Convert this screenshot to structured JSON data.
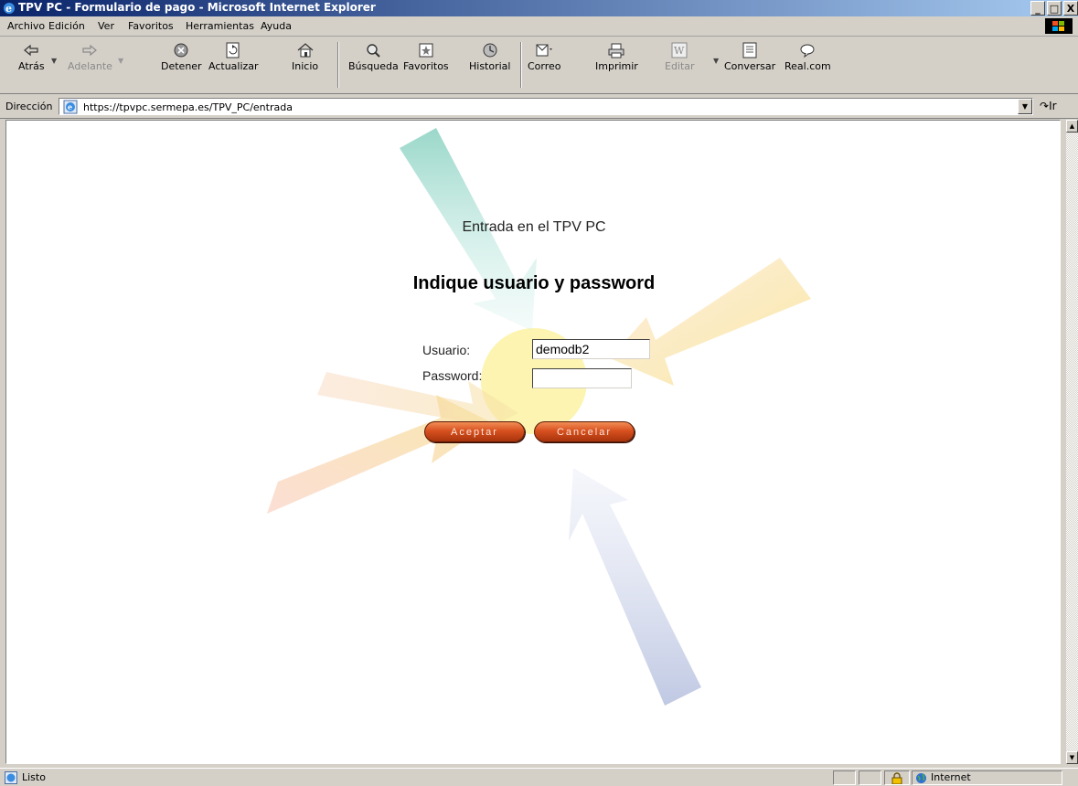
{
  "window": {
    "title": "TPV PC - Formulario de pago - Microsoft Internet Explorer",
    "controls": [
      "_",
      "□",
      "X"
    ]
  },
  "menu": {
    "items": [
      "Archivo",
      "Edición",
      "Ver",
      "Favoritos",
      "Herramientas",
      "Ayuda"
    ]
  },
  "toolbar": {
    "buttons": [
      {
        "label": "Atrás",
        "icon": "back-arrow-icon"
      },
      {
        "label": "Adelante",
        "icon": "forward-arrow-icon",
        "disabled": true
      },
      {
        "label": "Detener",
        "icon": "stop-icon"
      },
      {
        "label": "Actualizar",
        "icon": "refresh-icon"
      },
      {
        "label": "Inicio",
        "icon": "home-icon"
      },
      {
        "label": "Búsqueda",
        "icon": "search-icon"
      },
      {
        "label": "Favoritos",
        "icon": "favorites-icon"
      },
      {
        "label": "Historial",
        "icon": "history-icon"
      },
      {
        "label": "Correo",
        "icon": "mail-icon"
      },
      {
        "label": "Imprimir",
        "icon": "print-icon"
      },
      {
        "label": "Editar",
        "icon": "edit-icon",
        "disabled": true
      },
      {
        "label": "Conversar",
        "icon": "discuss-icon"
      },
      {
        "label": "Real.com",
        "icon": "realcom-icon"
      }
    ]
  },
  "address": {
    "label": "Dirección",
    "url": "https://tpvpc.sermepa.es/TPV_PC/entrada",
    "go_label": "Ir"
  },
  "page": {
    "entrada_title": "Entrada en el TPV PC",
    "heading": "Indique usuario y password",
    "usuario_label": "Usuario:",
    "usuario_value": "demodb2",
    "password_label": "Password:",
    "password_value": "",
    "aceptar_label": "Aceptar",
    "cancelar_label": "Cancelar"
  },
  "status": {
    "text": "Listo",
    "zone": "Internet"
  },
  "colors": {
    "titlebar_start": "#0a246a",
    "titlebar_end": "#a6caf0",
    "button_orange": "#d7501f"
  }
}
